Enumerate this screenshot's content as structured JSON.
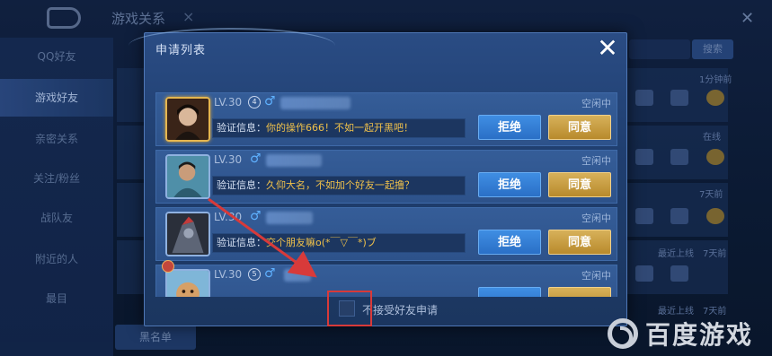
{
  "background": {
    "title": "游戏关系",
    "close_glyph": "×",
    "corner_glyph": "✕",
    "search_label": "搜索",
    "sidebar": [
      {
        "label": "QQ好友",
        "active": false
      },
      {
        "label": "游戏好友",
        "active": true
      },
      {
        "label": "亲密关系",
        "active": false
      },
      {
        "label": "关注/粉丝",
        "active": false
      },
      {
        "label": "战队友",
        "active": false
      },
      {
        "label": "附近的人",
        "active": false
      },
      {
        "label": "最目",
        "active": false
      }
    ],
    "blacklist_label": "黑名单",
    "row_texts": [
      "1分钟前",
      "在线",
      "7天前",
      "最近上线",
      "7天前",
      "最近上线",
      "7天前"
    ]
  },
  "modal": {
    "title": "申请列表",
    "close_glyph": "✕",
    "requests": [
      {
        "level": "LV.30",
        "rank": "4",
        "gender": "♂",
        "status": "空闲中",
        "verify_label": "验证信息：",
        "verify_message": "你的操作666！不如一起开黑吧！",
        "reject_label": "拒绝",
        "accept_label": "同意"
      },
      {
        "level": "LV.30",
        "rank": "",
        "gender": "♂",
        "status": "空闲中",
        "verify_label": "验证信息：",
        "verify_message": "久仰大名，不如加个好友一起撸？",
        "reject_label": "拒绝",
        "accept_label": "同意"
      },
      {
        "level": "LV.30",
        "rank": "",
        "gender": "♂",
        "status": "空闲中",
        "verify_label": "验证信息：",
        "verify_message": "交个朋友嘛o(*￣▽￣*)ブ",
        "reject_label": "拒绝",
        "accept_label": "同意"
      },
      {
        "level": "LV.30",
        "rank": "5",
        "gender": "♂",
        "status": "空闲中",
        "verify_label": "",
        "verify_message": "",
        "reject_label": "",
        "accept_label": ""
      }
    ],
    "footer_checkbox_label": "不接受好友申请",
    "footer_checked": false
  },
  "watermark": {
    "text": "百度游戏"
  },
  "colors": {
    "accent_blue": "#2a6fc6",
    "accent_gold": "#b88a2c",
    "highlight_text": "#f0c14a",
    "annotation_red": "#d83a3a"
  }
}
